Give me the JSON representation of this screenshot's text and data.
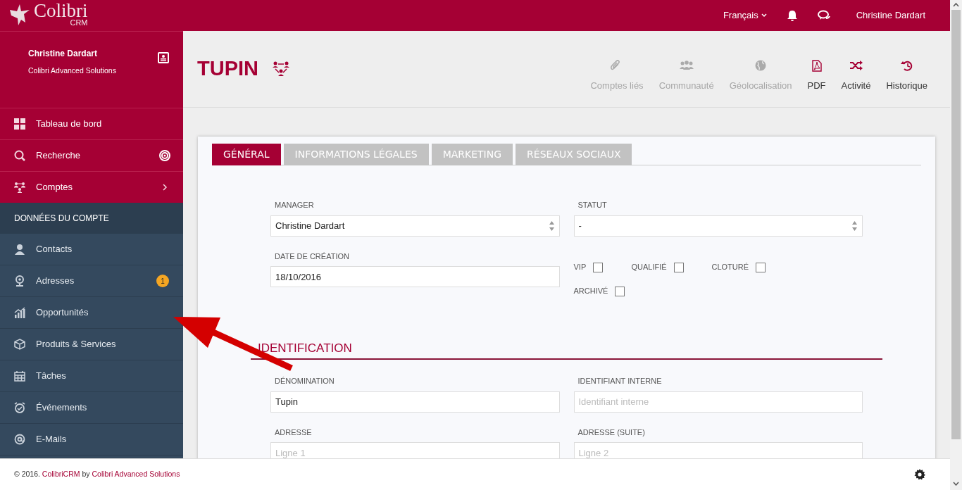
{
  "header": {
    "logo": {
      "name": "Colibri",
      "sub": "CRM"
    },
    "language": "Français",
    "user": "Christine Dardart"
  },
  "profile": {
    "name": "Christine Dardart",
    "company": "Colibri Advanced Solutions"
  },
  "nav_main": [
    {
      "label": "Tableau de bord"
    },
    {
      "label": "Recherche"
    },
    {
      "label": "Comptes"
    }
  ],
  "section_title": "DONNÉES DU COMPTE",
  "nav_account": [
    {
      "label": "Contacts"
    },
    {
      "label": "Adresses",
      "badge": "1"
    },
    {
      "label": "Opportunités"
    },
    {
      "label": "Produits & Services"
    },
    {
      "label": "Tâches"
    },
    {
      "label": "Événements"
    },
    {
      "label": "E-Mails"
    }
  ],
  "page_title": "TUPIN",
  "actions": [
    {
      "label": "Comptes liés",
      "disabled": true
    },
    {
      "label": "Communauté",
      "disabled": true
    },
    {
      "label": "Géolocalisation",
      "disabled": true
    },
    {
      "label": "PDF",
      "disabled": false
    },
    {
      "label": "Activité",
      "disabled": false
    },
    {
      "label": "Historique",
      "disabled": false
    }
  ],
  "tabs": [
    {
      "label": "GÉNÉRAL",
      "selected": true
    },
    {
      "label": "INFORMATIONS LÉGALES",
      "selected": false
    },
    {
      "label": "MARKETING",
      "selected": false
    },
    {
      "label": "RÉSEAUX SOCIAUX",
      "selected": false
    }
  ],
  "general": {
    "manager": {
      "label": "MANAGER",
      "value": "Christine Dardart"
    },
    "statut": {
      "label": "STATUT",
      "value": "-"
    },
    "date": {
      "label": "DATE DE CRÉATION",
      "value": "18/10/2016"
    },
    "checkboxes": [
      {
        "label": "VIP",
        "checked": false
      },
      {
        "label": "QUALIFIÉ",
        "checked": false
      },
      {
        "label": "CLOTURÉ",
        "checked": false
      },
      {
        "label": "ARCHIVÉ",
        "checked": false
      }
    ]
  },
  "identification": {
    "title": "IDENTIFICATION",
    "fields": [
      {
        "label": "DÉNOMINATION",
        "value": "Tupin"
      },
      {
        "label": "IDENTIFIANT INTERNE",
        "placeholder": "Identifiant interne"
      },
      {
        "label": "ADRESSE",
        "placeholder": "Ligne 1"
      },
      {
        "label": "ADRESSE (SUITE)",
        "placeholder": "Ligne 2"
      }
    ]
  },
  "footer": {
    "prefix": "© 2016.",
    "product": "ColibriCRM",
    "by": "by",
    "company": "Colibri Advanced Solutions"
  }
}
